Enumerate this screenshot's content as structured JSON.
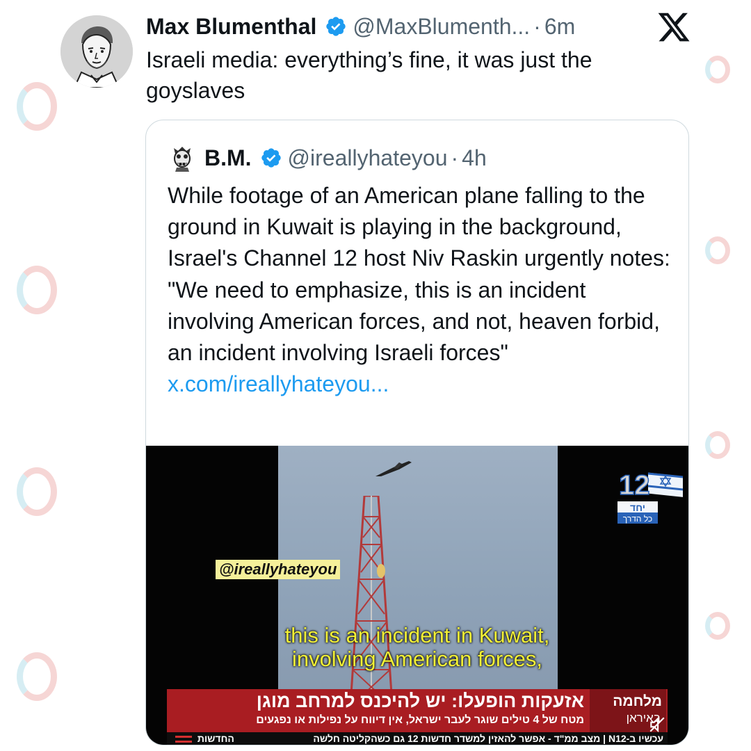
{
  "tweet": {
    "author_name": "Max Blumenthal",
    "handle": "@MaxBlumenth...",
    "separator": "·",
    "time": "6m",
    "text": "Israeli media: everything’s fine, it was just the goyslaves"
  },
  "quoted_tweet": {
    "author_name": "B.M.",
    "handle": "@ireallyhateyou",
    "separator": "·",
    "time": "4h",
    "text": "While footage of an American plane falling to the ground in Kuwait is playing in the background, Israel's Channel 12 host Niv Raskin urgently notes: \"We need to emphasize, this is an incident involving American forces, and not, heaven forbid, an incident involving Israeli forces\"",
    "link_text": "x.com/ireallyhateyou..."
  },
  "video": {
    "watermark_handle": "@ireallyhateyou",
    "subtitle_line1": "this is an incident in Kuwait,",
    "subtitle_line2": "involving American forces,",
    "banner_headline": "אזעקות הופעלו: יש להיכנס למרחב מוגן",
    "banner_subline": "מטח של 4 טילים שוגר לעבר ישראל, אין דיווח על נפילות או נפגעים",
    "war_label": "מלחמה",
    "war_sublabel": "באיראן",
    "ticker_text": "עכשיו ב-N12 | מצב ממ\"ד - אפשר להאזין למשדר חדשות 12 גם כשהקליטה חלשה",
    "ticker_brand": "החדשות",
    "channel_number": "12",
    "channel_slogan_1": "יחד",
    "channel_slogan_2": "כל הדרך"
  },
  "colors": {
    "verified_blue": "#1d9bf0",
    "text_primary": "#0f1419",
    "text_muted": "#536471",
    "link": "#1d9bf0",
    "banner_red": "#a91d22",
    "subtitle_yellow": "#f2f035"
  },
  "icons": {
    "verified": "verified-badge-icon",
    "platform": "x-logo-icon",
    "muted": "muted-speaker-icon"
  }
}
